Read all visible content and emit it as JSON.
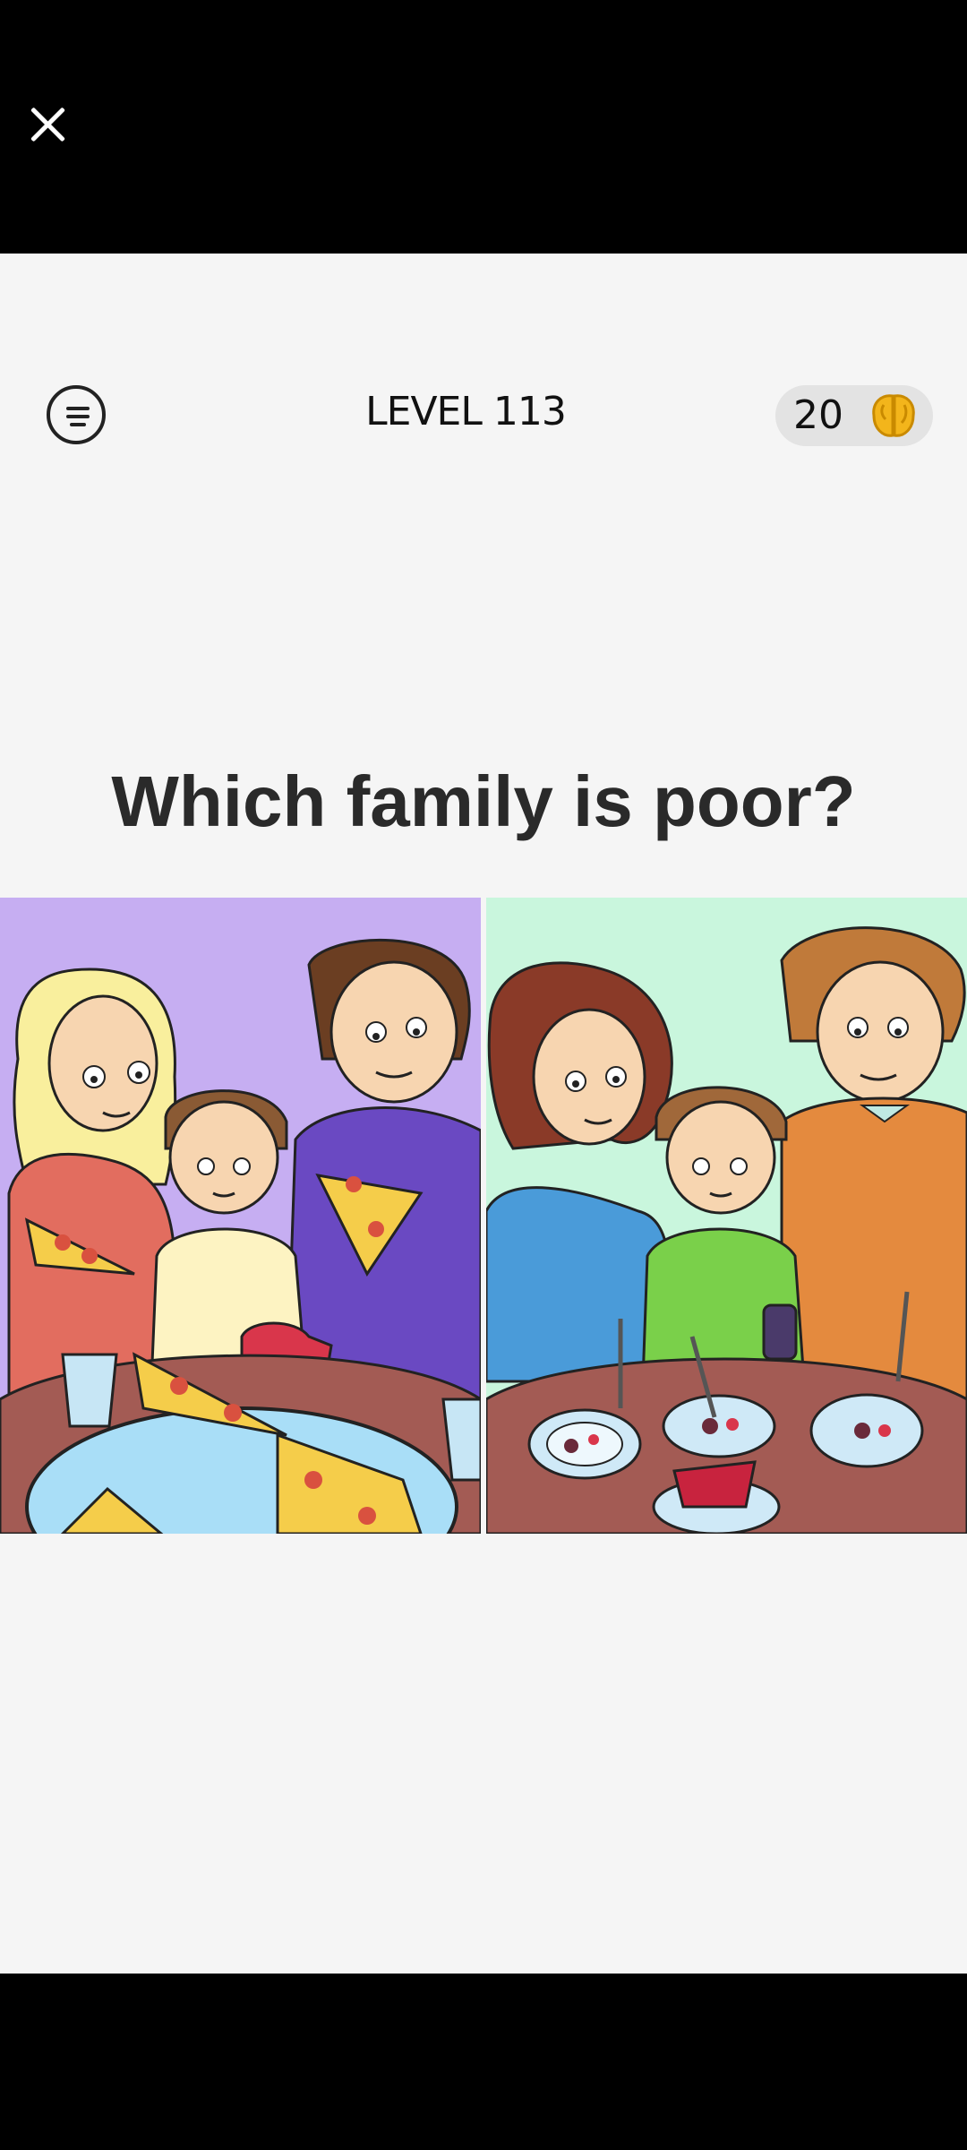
{
  "header": {
    "level_text": "LEVEL 113",
    "score": "20"
  },
  "question": "Which family is poor?",
  "icons": {
    "close": "close-icon",
    "menu": "menu-icon",
    "currency": "brain-icon"
  },
  "colors": {
    "panel_left_bg": "#c6aef2",
    "panel_right_bg": "#c9f6dd",
    "brain": "#f3b51b",
    "table": "#a35b54"
  },
  "options": [
    {
      "id": "left",
      "scene": "family eating pizza"
    },
    {
      "id": "right",
      "scene": "family eating dessert on plates"
    }
  ]
}
